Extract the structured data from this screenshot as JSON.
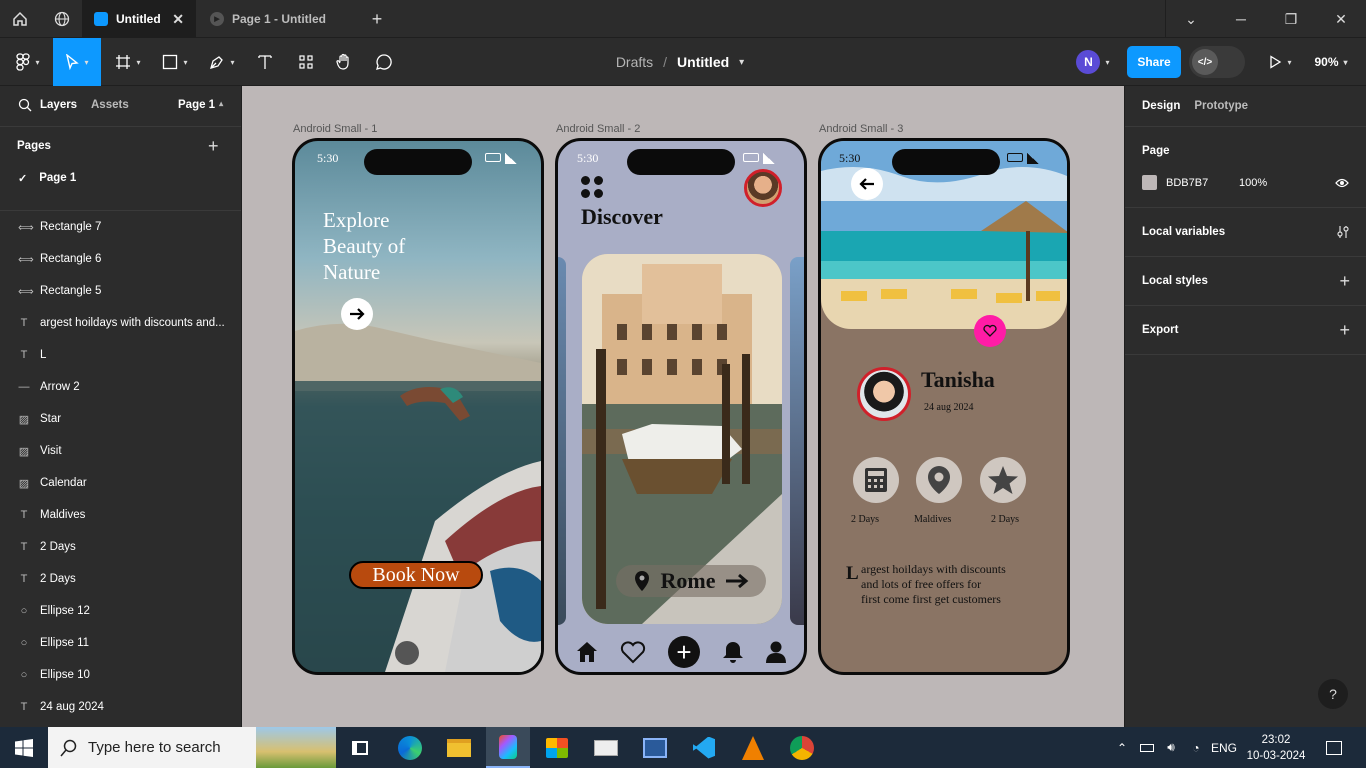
{
  "tabs": {
    "home_icon": "home-icon",
    "globe_icon": "globe-icon",
    "active": "Untitled",
    "second": "Page 1 - Untitled",
    "add": "+"
  },
  "toolbar": {
    "breadcrumb_parent": "Drafts",
    "breadcrumb_sep": "/",
    "file_name": "Untitled",
    "avatar_initial": "N",
    "share": "Share",
    "zoom": "90%"
  },
  "left_panel": {
    "tab_layers": "Layers",
    "tab_assets": "Assets",
    "page_selector": "Page 1",
    "pages_title": "Pages",
    "current_page": "Page 1",
    "layers": [
      {
        "icon": "link",
        "label": "Rectangle 7"
      },
      {
        "icon": "link",
        "label": "Rectangle 6"
      },
      {
        "icon": "link",
        "label": "Rectangle 5"
      },
      {
        "icon": "T",
        "label": "argest hoildays with discounts and..."
      },
      {
        "icon": "T",
        "label": "L"
      },
      {
        "icon": "line",
        "label": "Arrow 2"
      },
      {
        "icon": "image",
        "label": "Star"
      },
      {
        "icon": "image",
        "label": "Visit"
      },
      {
        "icon": "image",
        "label": "Calendar"
      },
      {
        "icon": "T",
        "label": "Maldives"
      },
      {
        "icon": "T",
        "label": "2 Days"
      },
      {
        "icon": "T",
        "label": "2 Days"
      },
      {
        "icon": "ellipse",
        "label": "Ellipse 12"
      },
      {
        "icon": "ellipse",
        "label": "Ellipse 11"
      },
      {
        "icon": "ellipse",
        "label": "Ellipse 10"
      },
      {
        "icon": "T",
        "label": "24 aug 2024"
      }
    ]
  },
  "frames": {
    "f1": {
      "label": "Android Small - 1",
      "time": "5:30",
      "headline1": "Explore",
      "headline2": "Beauty of",
      "headline3": "Nature",
      "cta": "Book Now"
    },
    "f2": {
      "label": "Android Small - 2",
      "time": "5:30",
      "title": "Discover",
      "city": "Rome"
    },
    "f3": {
      "label": "Android Small - 3",
      "time": "5:30",
      "name": "Tanisha",
      "date": "24 aug 2024",
      "stat1": "2 Days",
      "stat2": "Maldives",
      "stat3": "2 Days",
      "drop_cap": "L",
      "desc1": "argest hoildays with discounts",
      "desc2": "and lots of free offers for",
      "desc3": "first come first get customers"
    }
  },
  "right_panel": {
    "tab_design": "Design",
    "tab_prototype": "Prototype",
    "page_title": "Page",
    "bg_hex": "BDB7B7",
    "bg_opacity": "100%",
    "local_variables": "Local variables",
    "local_styles": "Local styles",
    "export": "Export",
    "help": "?"
  },
  "taskbar": {
    "search_placeholder": "Type here to search",
    "lang": "ENG",
    "time": "23:02",
    "date": "10-03-2024"
  },
  "colors": {
    "canvas": "#bdb7b7",
    "accent": "#0d99ff",
    "phone2_bg": "#a9aec6",
    "phone3_bg": "#8a7464",
    "pink": "#ff1ca6",
    "book_btn": "#b84a0e"
  }
}
